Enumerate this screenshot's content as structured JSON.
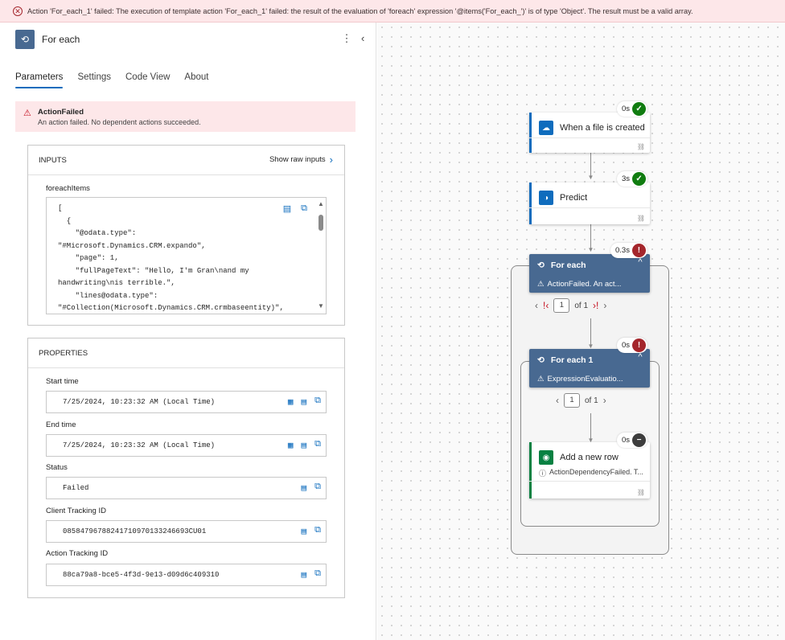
{
  "banner": {
    "message": "Action 'For_each_1' failed: The execution of template action 'For_each_1' failed: the result of the evaluation of 'foreach' expression '@items('For_each_')' is of type 'Object'. The result must be a valid array."
  },
  "panel": {
    "title": "For each",
    "tabs": [
      "Parameters",
      "Settings",
      "Code View",
      "About"
    ],
    "alert": {
      "title": "ActionFailed",
      "message": "An action failed. No dependent actions succeeded."
    },
    "inputs": {
      "header": "INPUTS",
      "show_raw": "Show raw inputs",
      "field_label": "foreachItems",
      "code": "[\n  {\n    \"@odata.type\":\n\"#Microsoft.Dynamics.CRM.expando\",\n    \"page\": 1,\n    \"fullPageText\": \"Hello, I'm Gran\\nand my\nhandwriting\\nis terrible.\",\n    \"lines@odata.type\":\n\"#Collection(Microsoft.Dynamics.CRM.crmbaseentity)\","
    },
    "properties": {
      "header": "PROPERTIES",
      "start_label": "Start time",
      "start_value": "7/25/2024, 10:23:32 AM (Local Time)",
      "end_label": "End time",
      "end_value": "7/25/2024, 10:23:32 AM (Local Time)",
      "status_label": "Status",
      "status_value": "Failed",
      "client_label": "Client Tracking ID",
      "client_value": "08584796788241710970133246693CU01",
      "action_label": "Action Tracking ID",
      "action_value": "88ca79a8-bce5-4f3d-9e13-d09d6c409310"
    }
  },
  "flow": {
    "trigger": {
      "title": "When a file is created",
      "duration": "0s",
      "status": "success"
    },
    "predict": {
      "title": "Predict",
      "duration": "3s",
      "status": "success"
    },
    "foreach": {
      "title": "For each",
      "subtitle": "ActionFailed. An act...",
      "duration": "0.3s",
      "status": "failed",
      "page": "1",
      "of": "of 1"
    },
    "foreach1": {
      "title": "For each 1",
      "subtitle": "ExpressionEvaluatio...",
      "duration": "0s",
      "status": "failed",
      "page": "1",
      "of": "of 1"
    },
    "addrow": {
      "title": "Add a new row",
      "subtitle": "ActionDependencyFailed. T...",
      "duration": "0s",
      "status": "skipped"
    }
  },
  "colors": {
    "accent": "#0f6cbd",
    "success": "#107c10",
    "error": "#a4262c",
    "loop": "#486991",
    "dataverse": "#088142"
  }
}
